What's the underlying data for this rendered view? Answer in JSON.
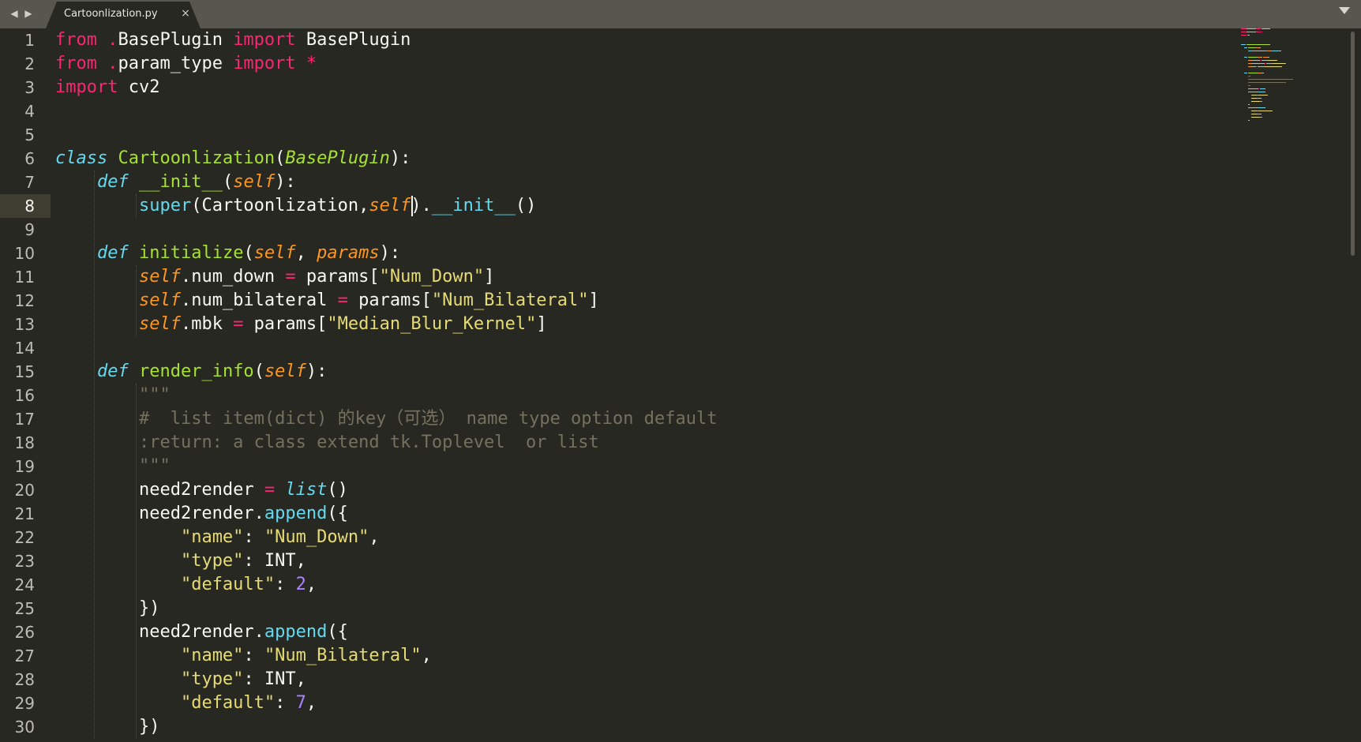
{
  "tabs": [
    {
      "label": "Cartoonlization.py",
      "active": true,
      "close_symbol": "×"
    }
  ],
  "nav": {
    "back_icon": "◀",
    "forward_icon": "▶"
  },
  "editor": {
    "language": "Python",
    "theme": "Monokai",
    "active_line": 8,
    "line_numbers": [
      "1",
      "2",
      "3",
      "4",
      "5",
      "6",
      "7",
      "8",
      "9",
      "10",
      "11",
      "12",
      "13",
      "14",
      "15",
      "16",
      "17",
      "18",
      "19",
      "20",
      "21",
      "22",
      "23",
      "24",
      "25",
      "26",
      "27",
      "28",
      "29",
      "30"
    ],
    "lines": [
      [
        [
          "kw",
          "from "
        ],
        [
          "op",
          "."
        ],
        [
          "plain",
          "BasePlugin "
        ],
        [
          "kw",
          "import"
        ],
        [
          "plain",
          " BasePlugin"
        ]
      ],
      [
        [
          "kw",
          "from "
        ],
        [
          "op",
          "."
        ],
        [
          "plain",
          "param_type "
        ],
        [
          "kw",
          "import"
        ],
        [
          "plain",
          " "
        ],
        [
          "op",
          "*"
        ]
      ],
      [
        [
          "kw",
          "import"
        ],
        [
          "plain",
          " cv2"
        ]
      ],
      [],
      [],
      [
        [
          "store",
          "class"
        ],
        [
          "plain",
          " "
        ],
        [
          "name",
          "Cartoonlization"
        ],
        [
          "plain",
          "("
        ],
        [
          "inherit",
          "BasePlugin"
        ],
        [
          "plain",
          "):"
        ]
      ],
      [
        [
          "plain",
          "    "
        ],
        [
          "store",
          "def"
        ],
        [
          "plain",
          " "
        ],
        [
          "name",
          "__init__"
        ],
        [
          "plain",
          "("
        ],
        [
          "param",
          "self"
        ],
        [
          "plain",
          "):"
        ]
      ],
      [
        [
          "plain",
          "        "
        ],
        [
          "builtin",
          "super"
        ],
        [
          "plain",
          "(Cartoonlization,"
        ],
        [
          "param",
          "self"
        ],
        [
          "plain",
          ")."
        ],
        [
          "builtin",
          "__init__"
        ],
        [
          "plain",
          "()"
        ]
      ],
      [],
      [
        [
          "plain",
          "    "
        ],
        [
          "store",
          "def"
        ],
        [
          "plain",
          " "
        ],
        [
          "name",
          "initialize"
        ],
        [
          "plain",
          "("
        ],
        [
          "param",
          "self"
        ],
        [
          "plain",
          ", "
        ],
        [
          "param",
          "params"
        ],
        [
          "plain",
          "):"
        ]
      ],
      [
        [
          "plain",
          "        "
        ],
        [
          "param",
          "self"
        ],
        [
          "plain",
          ".num_down "
        ],
        [
          "op",
          "="
        ],
        [
          "plain",
          " params["
        ],
        [
          "string",
          "\"Num_Down\""
        ],
        [
          "plain",
          "]"
        ]
      ],
      [
        [
          "plain",
          "        "
        ],
        [
          "param",
          "self"
        ],
        [
          "plain",
          ".num_bilateral "
        ],
        [
          "op",
          "="
        ],
        [
          "plain",
          " params["
        ],
        [
          "string",
          "\"Num_Bilateral\""
        ],
        [
          "plain",
          "]"
        ]
      ],
      [
        [
          "plain",
          "        "
        ],
        [
          "param",
          "self"
        ],
        [
          "plain",
          ".mbk "
        ],
        [
          "op",
          "="
        ],
        [
          "plain",
          " params["
        ],
        [
          "string",
          "\"Median_Blur_Kernel\""
        ],
        [
          "plain",
          "]"
        ]
      ],
      [],
      [
        [
          "plain",
          "    "
        ],
        [
          "store",
          "def"
        ],
        [
          "plain",
          " "
        ],
        [
          "name",
          "render_info"
        ],
        [
          "plain",
          "("
        ],
        [
          "param",
          "self"
        ],
        [
          "plain",
          "):"
        ]
      ],
      [
        [
          "plain",
          "        "
        ],
        [
          "comment",
          "\"\"\""
        ]
      ],
      [
        [
          "plain",
          "        "
        ],
        [
          "comment",
          "#  list item(dict) 的key（可选） name type option default"
        ]
      ],
      [
        [
          "plain",
          "        "
        ],
        [
          "comment",
          ":return: a class extend tk.Toplevel  or list"
        ]
      ],
      [
        [
          "plain",
          "        "
        ],
        [
          "comment",
          "\"\"\""
        ]
      ],
      [
        [
          "plain",
          "        need2render "
        ],
        [
          "op",
          "="
        ],
        [
          "plain",
          " "
        ],
        [
          "builtin-it",
          "list"
        ],
        [
          "plain",
          "()"
        ]
      ],
      [
        [
          "plain",
          "        need2render."
        ],
        [
          "builtin",
          "append"
        ],
        [
          "plain",
          "({"
        ]
      ],
      [
        [
          "plain",
          "            "
        ],
        [
          "string",
          "\"name\""
        ],
        [
          "plain",
          ": "
        ],
        [
          "string",
          "\"Num_Down\""
        ],
        [
          "plain",
          ","
        ]
      ],
      [
        [
          "plain",
          "            "
        ],
        [
          "string",
          "\"type\""
        ],
        [
          "plain",
          ": INT,"
        ]
      ],
      [
        [
          "plain",
          "            "
        ],
        [
          "string",
          "\"default\""
        ],
        [
          "plain",
          ": "
        ],
        [
          "num",
          "2"
        ],
        [
          "plain",
          ","
        ]
      ],
      [
        [
          "plain",
          "        })"
        ]
      ],
      [
        [
          "plain",
          "        need2render."
        ],
        [
          "builtin",
          "append"
        ],
        [
          "plain",
          "({"
        ]
      ],
      [
        [
          "plain",
          "            "
        ],
        [
          "string",
          "\"name\""
        ],
        [
          "plain",
          ": "
        ],
        [
          "string",
          "\"Num_Bilateral\""
        ],
        [
          "plain",
          ","
        ]
      ],
      [
        [
          "plain",
          "            "
        ],
        [
          "string",
          "\"type\""
        ],
        [
          "plain",
          ": INT,"
        ]
      ],
      [
        [
          "plain",
          "            "
        ],
        [
          "string",
          "\"default\""
        ],
        [
          "plain",
          ": "
        ],
        [
          "num",
          "7"
        ],
        [
          "plain",
          ","
        ]
      ],
      [
        [
          "plain",
          "        })"
        ]
      ]
    ]
  },
  "colors": {
    "background": "#272822",
    "tabbar": "#57574f",
    "keyword": "#f92672",
    "storage": "#66d9ef",
    "function_name": "#a6e22e",
    "parameter": "#fd971f",
    "string": "#e6db74",
    "number": "#ae81ff",
    "comment": "#75715e",
    "foreground": "#f8f8f2"
  }
}
